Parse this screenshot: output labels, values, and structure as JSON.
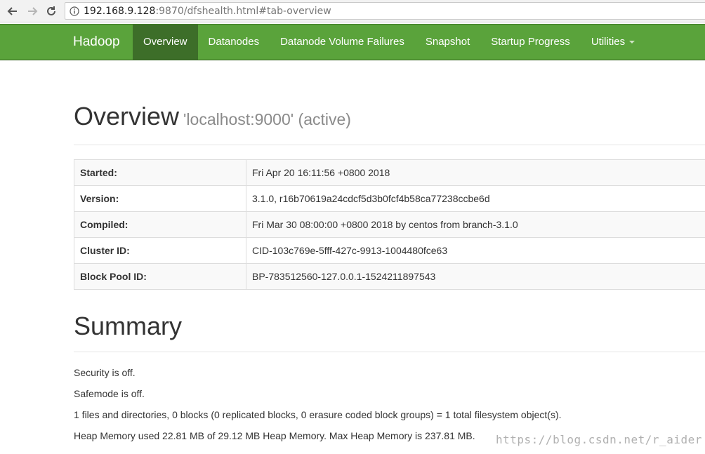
{
  "browser": {
    "url_host": "192.168.9.128",
    "url_rest": ":9870/dfshealth.html#tab-overview"
  },
  "navbar": {
    "brand": "Hadoop",
    "items": [
      {
        "label": "Overview",
        "active": true
      },
      {
        "label": "Datanodes"
      },
      {
        "label": "Datanode Volume Failures"
      },
      {
        "label": "Snapshot"
      },
      {
        "label": "Startup Progress"
      },
      {
        "label": "Utilities"
      }
    ]
  },
  "overview": {
    "title": "Overview",
    "subtitle": "'localhost:9000' (active)",
    "rows": [
      {
        "label": "Started:",
        "value": "Fri Apr 20 16:11:56 +0800 2018"
      },
      {
        "label": "Version:",
        "value": "3.1.0, r16b70619a24cdcf5d3b0fcf4b58ca77238ccbe6d"
      },
      {
        "label": "Compiled:",
        "value": "Fri Mar 30 08:00:00 +0800 2018 by centos from branch-3.1.0"
      },
      {
        "label": "Cluster ID:",
        "value": "CID-103c769e-5fff-427c-9913-1004480fce63"
      },
      {
        "label": "Block Pool ID:",
        "value": "BP-783512560-127.0.0.1-1524211897543"
      }
    ]
  },
  "summary": {
    "title": "Summary",
    "lines": [
      "Security is off.",
      "Safemode is off.",
      "1 files and directories, 0 blocks (0 replicated blocks, 0 erasure coded block groups) = 1 total filesystem object(s).",
      "Heap Memory used 22.81 MB of 29.12 MB Heap Memory. Max Heap Memory is 237.81 MB."
    ]
  },
  "watermark": "https://blog.csdn.net/r_aider",
  "colors": {
    "navbar": "#5aa33b",
    "navbar_active": "#3d6e29"
  }
}
